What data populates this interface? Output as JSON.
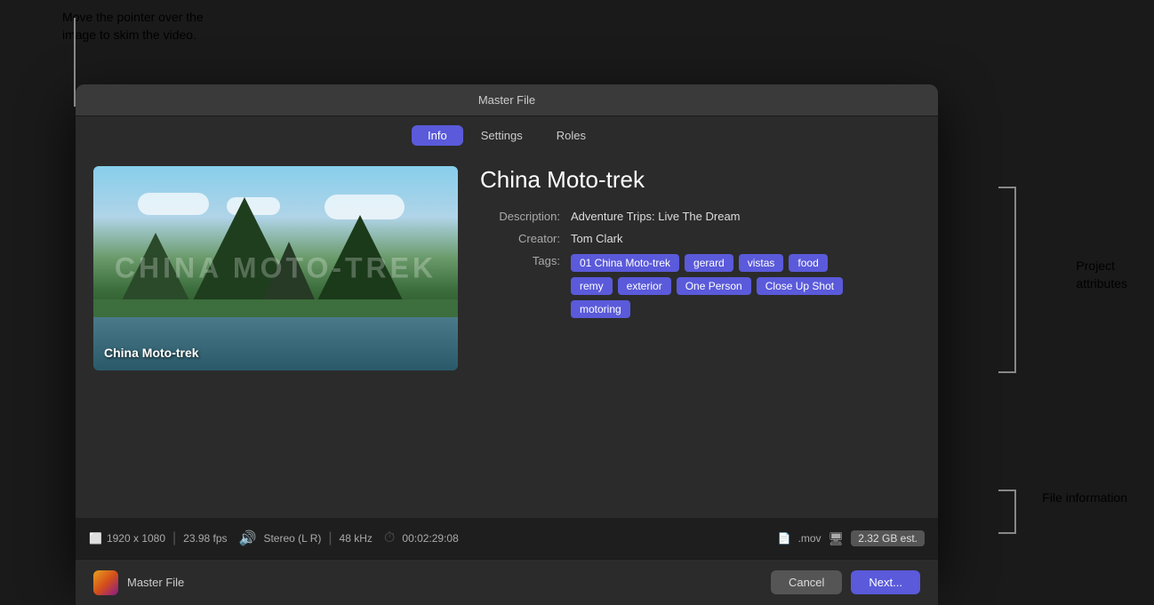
{
  "annotation_top": {
    "line1": "Move the pointer over the",
    "line2": "image to skim the video."
  },
  "annotation_right_attributes": "Project\nattributes",
  "annotation_right_file": "File information",
  "window": {
    "title": "Master File",
    "tabs": [
      {
        "label": "Info",
        "active": true
      },
      {
        "label": "Settings",
        "active": false
      },
      {
        "label": "Roles",
        "active": false
      }
    ]
  },
  "project": {
    "title": "China Moto-trek",
    "description_label": "Description:",
    "description_value": "Adventure Trips: Live The Dream",
    "creator_label": "Creator:",
    "creator_value": "Tom Clark",
    "tags_label": "Tags:",
    "tags": [
      "01 China Moto-trek",
      "gerard",
      "vistas",
      "food",
      "remy",
      "exterior",
      "One Person",
      "Close Up Shot",
      "motoring"
    ]
  },
  "video": {
    "overlay_text": "China Moto-trek",
    "watermark": "CHINA MOTO-TREK"
  },
  "file_info": {
    "resolution": "1920 x 1080",
    "fps": "23.98 fps",
    "audio": "Stereo (L R)",
    "sample_rate": "48 kHz",
    "duration": "00:02:29:08",
    "format": ".mov",
    "size": "2.32 GB est."
  },
  "footer": {
    "app_title": "Master File",
    "cancel_label": "Cancel",
    "next_label": "Next..."
  }
}
